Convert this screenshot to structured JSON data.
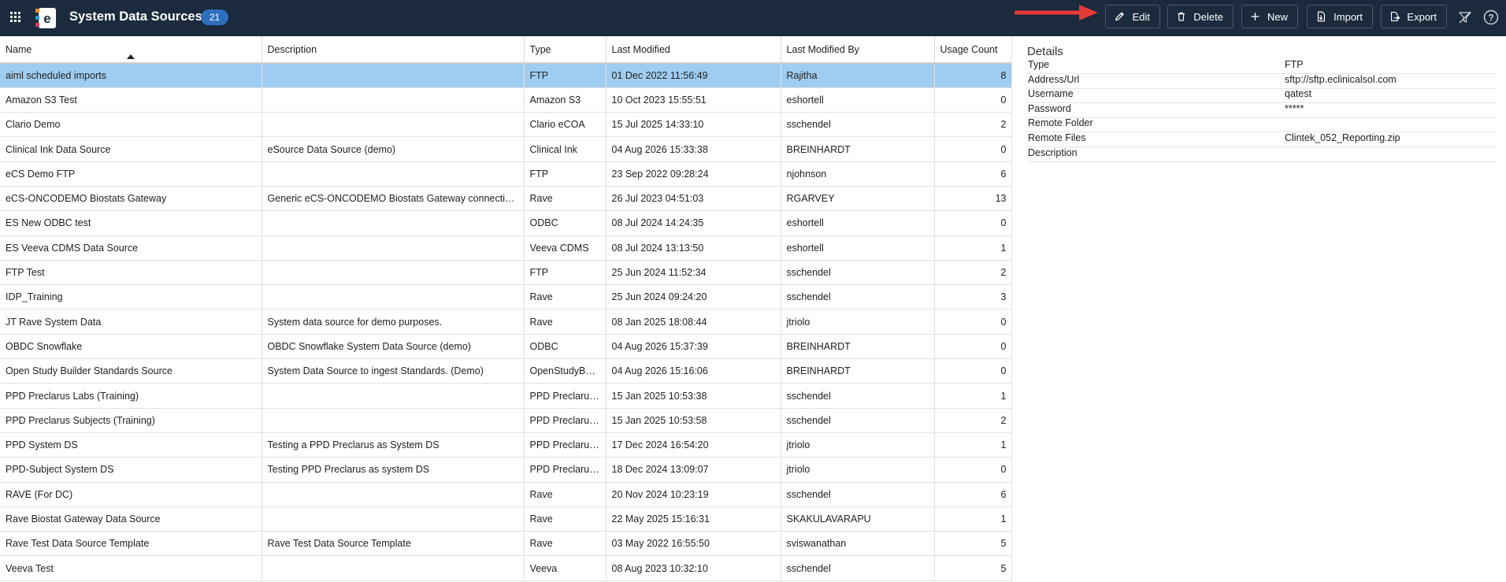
{
  "header": {
    "title": "System Data Sources",
    "count": "21"
  },
  "toolbar": {
    "edit": "Edit",
    "delete": "Delete",
    "new": "New",
    "import": "Import",
    "export": "Export"
  },
  "table": {
    "columns": [
      "Name",
      "Description",
      "Type",
      "Last Modified",
      "Last Modified By",
      "Usage Count"
    ],
    "rows": [
      {
        "name": "aiml scheduled imports",
        "description": "",
        "type": "FTP",
        "modified": "01 Dec 2022 11:56:49",
        "by": "Rajitha",
        "count": "8"
      },
      {
        "name": "Amazon S3 Test",
        "description": "",
        "type": "Amazon S3",
        "modified": "10 Oct 2023 15:55:51",
        "by": "eshortell",
        "count": "0"
      },
      {
        "name": "Clario Demo",
        "description": "",
        "type": "Clario eCOA",
        "modified": "15 Jul 2025 14:33:10",
        "by": "sschendel",
        "count": "2"
      },
      {
        "name": "Clinical Ink Data Source",
        "description": "eSource Data Source (demo)",
        "type": "Clinical Ink",
        "modified": "04 Aug 2026 15:33:38",
        "by": "BREINHARDT",
        "count": "0"
      },
      {
        "name": "eCS Demo FTP",
        "description": "",
        "type": "FTP",
        "modified": "23 Sep 2022 09:28:24",
        "by": "njohnson",
        "count": "6"
      },
      {
        "name": "eCS-ONCODEMO Biostats Gateway",
        "description": "Generic eCS-ONCODEMO Biostats Gateway connection d...",
        "type": "Rave",
        "modified": "26 Jul 2023 04:51:03",
        "by": "RGARVEY",
        "count": "13"
      },
      {
        "name": "ES New ODBC test",
        "description": "",
        "type": "ODBC",
        "modified": "08 Jul 2024 14:24:35",
        "by": "eshortell",
        "count": "0"
      },
      {
        "name": "ES Veeva CDMS Data Source",
        "description": "",
        "type": "Veeva CDMS",
        "modified": "08 Jul 2024 13:13:50",
        "by": "eshortell",
        "count": "1"
      },
      {
        "name": "FTP Test",
        "description": "",
        "type": "FTP",
        "modified": "25 Jun 2024 11:52:34",
        "by": "sschendel",
        "count": "2"
      },
      {
        "name": "IDP_Training",
        "description": "",
        "type": "Rave",
        "modified": "25 Jun 2024 09:24:20",
        "by": "sschendel",
        "count": "3"
      },
      {
        "name": "JT Rave System Data",
        "description": "System data source for demo purposes.",
        "type": "Rave",
        "modified": "08 Jan 2025 18:08:44",
        "by": "jtriolo",
        "count": "0"
      },
      {
        "name": "OBDC Snowflake",
        "description": "OBDC Snowflake System Data Source (demo)",
        "type": "ODBC",
        "modified": "04 Aug 2026 15:37:39",
        "by": "BREINHARDT",
        "count": "0"
      },
      {
        "name": "Open Study Builder Standards Source",
        "description": "System Data Source to ingest Standards. (Demo)",
        "type": "OpenStudyBuil...",
        "modified": "04 Aug 2026 15:16:06",
        "by": "BREINHARDT",
        "count": "0"
      },
      {
        "name": "PPD Preclarus Labs (Training)",
        "description": "",
        "type": "PPD Preclarus ...",
        "modified": "15 Jan 2025 10:53:38",
        "by": "sschendel",
        "count": "1"
      },
      {
        "name": "PPD Preclarus Subjects (Training)",
        "description": "",
        "type": "PPD Preclarus ...",
        "modified": "15 Jan 2025 10:53:58",
        "by": "sschendel",
        "count": "2"
      },
      {
        "name": "PPD System DS",
        "description": "Testing a PPD Preclarus as System DS",
        "type": "PPD Preclarus ...",
        "modified": "17 Dec 2024 16:54:20",
        "by": "jtriolo",
        "count": "1"
      },
      {
        "name": "PPD-Subject System DS",
        "description": "Testing PPD Preclarus as system DS",
        "type": "PPD Preclarus ...",
        "modified": "18 Dec 2024 13:09:07",
        "by": "jtriolo",
        "count": "0"
      },
      {
        "name": "RAVE (For DC)",
        "description": "",
        "type": "Rave",
        "modified": "20 Nov 2024 10:23:19",
        "by": "sschendel",
        "count": "6"
      },
      {
        "name": "Rave Biostat Gateway Data Source",
        "description": "",
        "type": "Rave",
        "modified": "22 May 2025 15:16:31",
        "by": "SKAKULAVARAPU",
        "count": "1"
      },
      {
        "name": "Rave Test Data Source Template",
        "description": "Rave Test Data Source Template",
        "type": "Rave",
        "modified": "03 May 2022 16:55:50",
        "by": "sviswanathan",
        "count": "5"
      },
      {
        "name": "Veeva Test",
        "description": "",
        "type": "Veeva",
        "modified": "08 Aug 2023 10:32:10",
        "by": "sschendel",
        "count": "5"
      }
    ]
  },
  "details": {
    "title": "Details",
    "fields": [
      {
        "label": "Type",
        "value": "FTP"
      },
      {
        "label": "Address/Url",
        "value": "sftp://sftp.eclinicalsol.com"
      },
      {
        "label": "Username",
        "value": "qatest"
      },
      {
        "label": "Password",
        "value": "*****"
      },
      {
        "label": "Remote Folder",
        "value": ""
      },
      {
        "label": "Remote Files",
        "value": "Clintek_052_Reporting.zip"
      },
      {
        "label": "Description",
        "value": ""
      }
    ]
  },
  "colors": {
    "topbar": "#1b2a3c",
    "badge": "#2e6fbd",
    "selected_row": "#9fcdf1",
    "arrow": "#e53935"
  },
  "icons": [
    "apps-grid-icon",
    "app-logo-icon",
    "red-arrow-icon",
    "pencil-icon",
    "trash-icon",
    "plus-icon",
    "import-icon",
    "export-icon",
    "filter-off-icon",
    "help-icon"
  ]
}
